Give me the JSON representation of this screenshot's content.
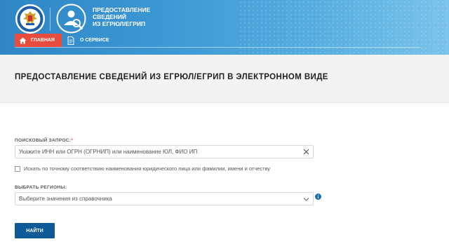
{
  "header": {
    "service_title_lines": [
      "ПРЕДОСТАВЛЕНИЕ",
      "СВЕДЕНИЙ",
      "ИЗ ЕГРЮЛ/ЕГРИП"
    ]
  },
  "nav": {
    "home_label": "ГЛАВНАЯ",
    "about_label": "О СЕРВИСЕ"
  },
  "page": {
    "title": "ПРЕДОСТАВЛЕНИЕ СВЕДЕНИЙ ИЗ ЕГРЮЛ/ЕГРИП В ЭЛЕКТРОННОМ ВИДЕ"
  },
  "search": {
    "label": "ПОИСКОВЫЙ ЗАПРОС:",
    "required_mark": "*",
    "placeholder": "Укажите ИНН или ОГРН (ОГРНИП) или наименование ЮЛ, ФИО ИП",
    "exact_match_label": "Искать по точному соответствию наименования юридического лица или фамилии, имени и отчеству"
  },
  "region": {
    "label": "ВЫБРАТЬ РЕГИОНЫ:",
    "placeholder": "Выберите значения из справочника"
  },
  "submit_label": "НАЙТИ",
  "colors": {
    "header_blue": "#3b97d3",
    "home_red": "#e74c3c",
    "submit_blue": "#0e5a97",
    "required_red": "#e74c3c",
    "info_blue": "#1a6fb5"
  }
}
